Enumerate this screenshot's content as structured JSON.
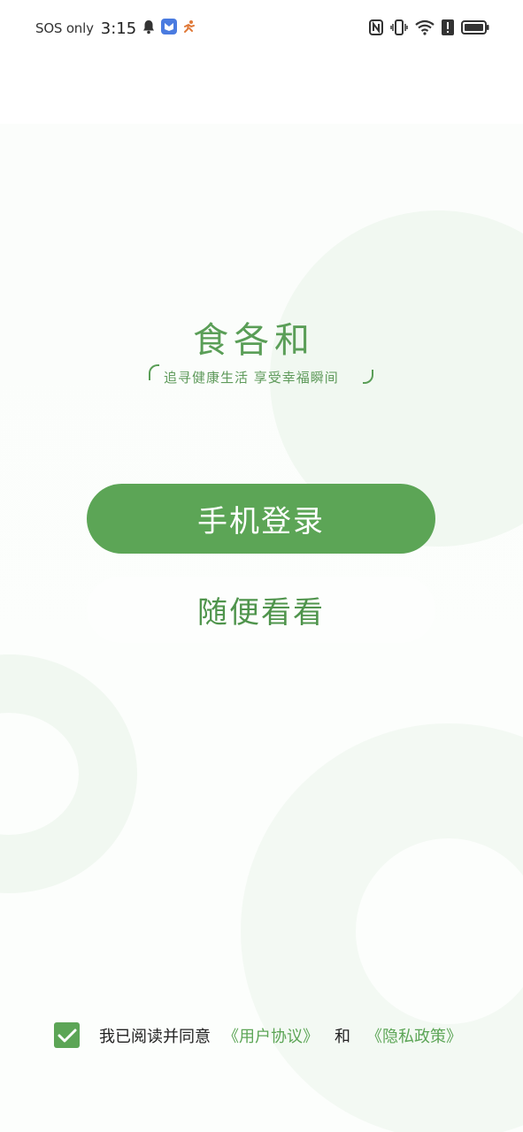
{
  "status_bar": {
    "carrier": "SOS only",
    "time": "3:15",
    "icons": [
      "bell-icon",
      "app-notification-icon",
      "running-icon",
      "nfc-icon",
      "vibrate-icon",
      "wifi-icon",
      "alert-icon",
      "battery-icon"
    ]
  },
  "logo": {
    "title": "食各和",
    "tagline": "追寻健康生活 享受幸福瞬间"
  },
  "buttons": {
    "login": "手机登录",
    "browse": "随便看看"
  },
  "agreement": {
    "checked": true,
    "prefix": "我已阅读并同意",
    "user_agreement": "《用户协议》",
    "and": "和",
    "privacy_policy": "《隐私政策》"
  },
  "colors": {
    "brand_green": "#5ca556",
    "background_circle": "#f1f8f1"
  }
}
